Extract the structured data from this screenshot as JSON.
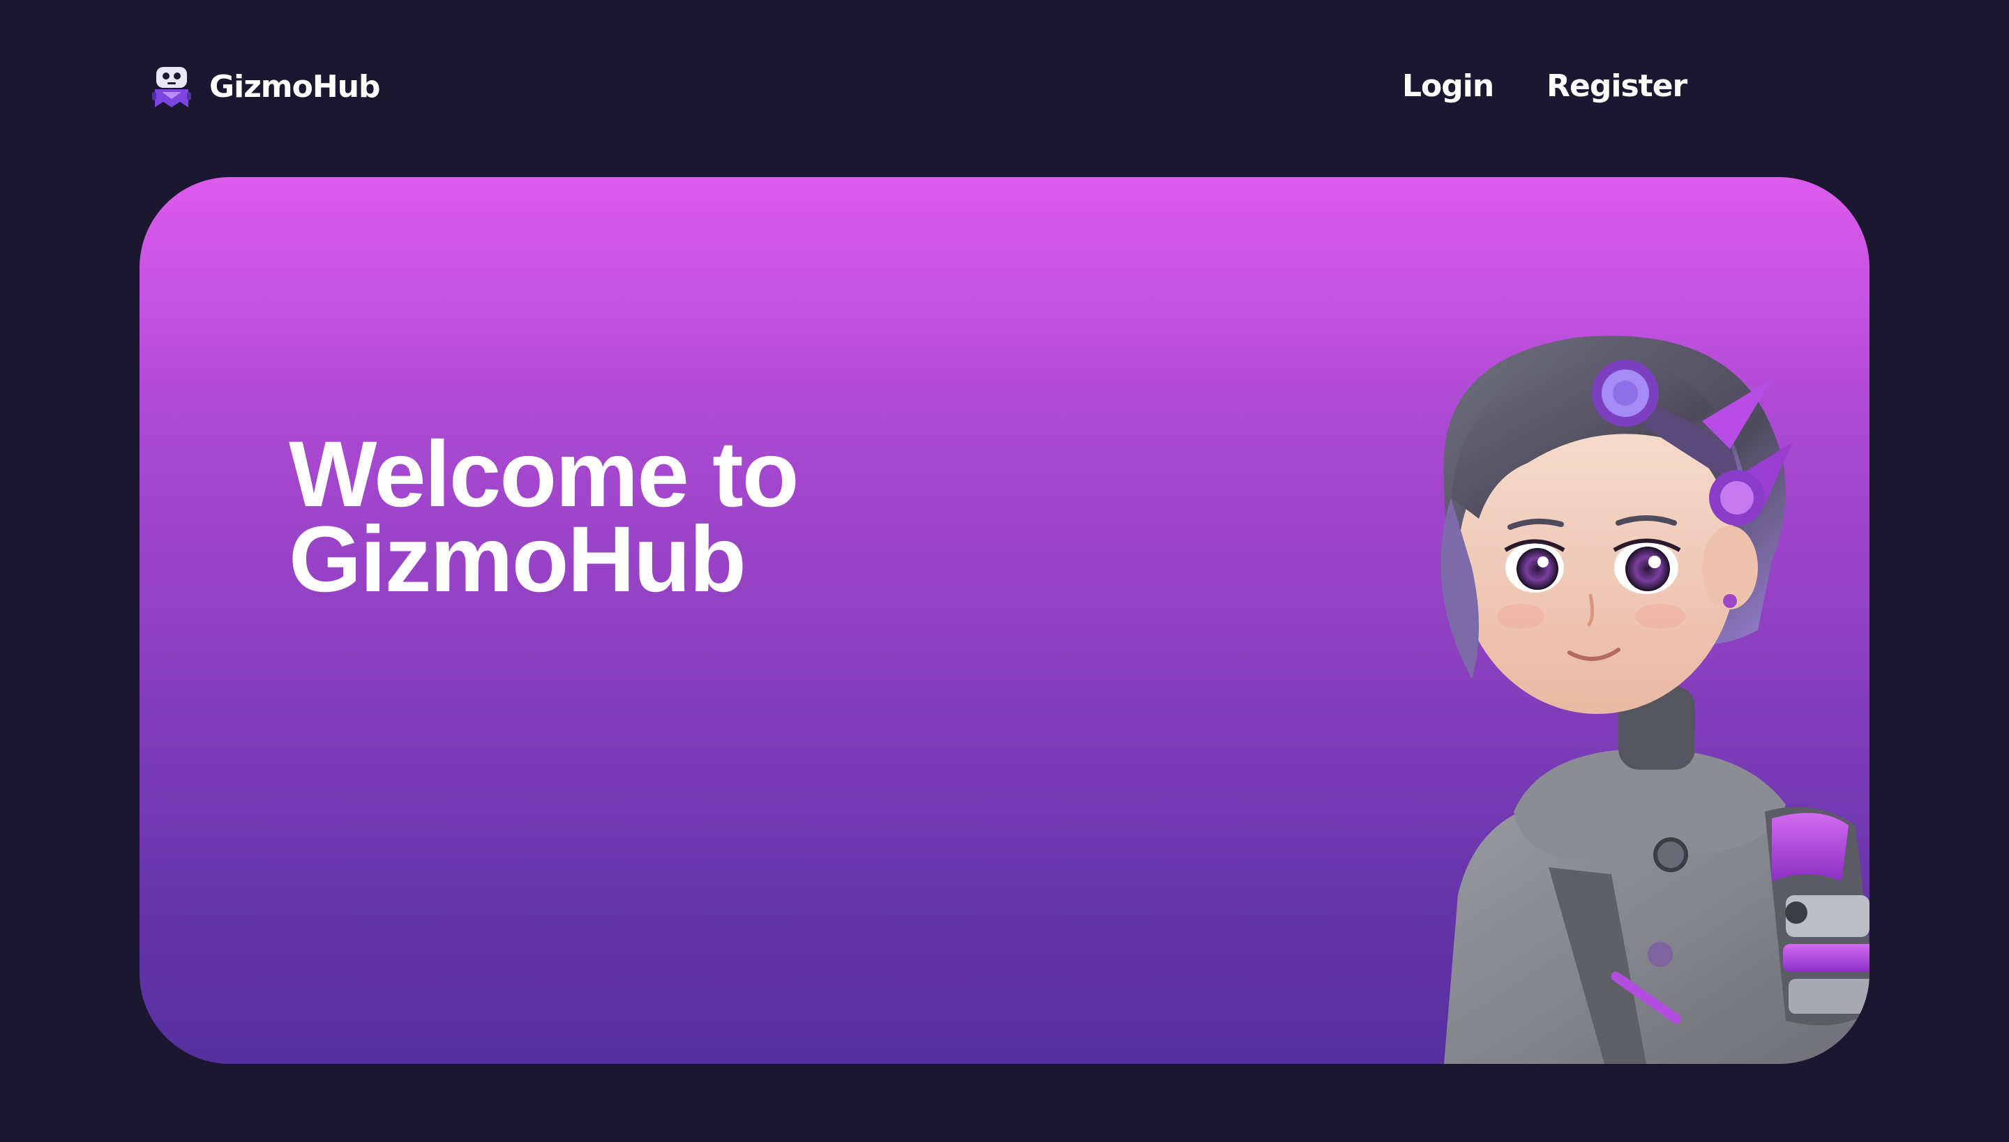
{
  "header": {
    "brand_name": "GizmoHub",
    "logo_icon": "robot-mascot-icon",
    "nav": {
      "login_label": "Login",
      "register_label": "Register"
    }
  },
  "hero": {
    "title_line_1": "Welcome to",
    "title_line_2": "GizmoHub",
    "image": "cyberpunk-girl-character-illustration"
  },
  "colors": {
    "background": "#1b1730",
    "hero_gradient_top": "#dd5bed",
    "hero_gradient_bottom": "#56309f",
    "text": "#ffffff",
    "accent": "#9b4bd8"
  }
}
